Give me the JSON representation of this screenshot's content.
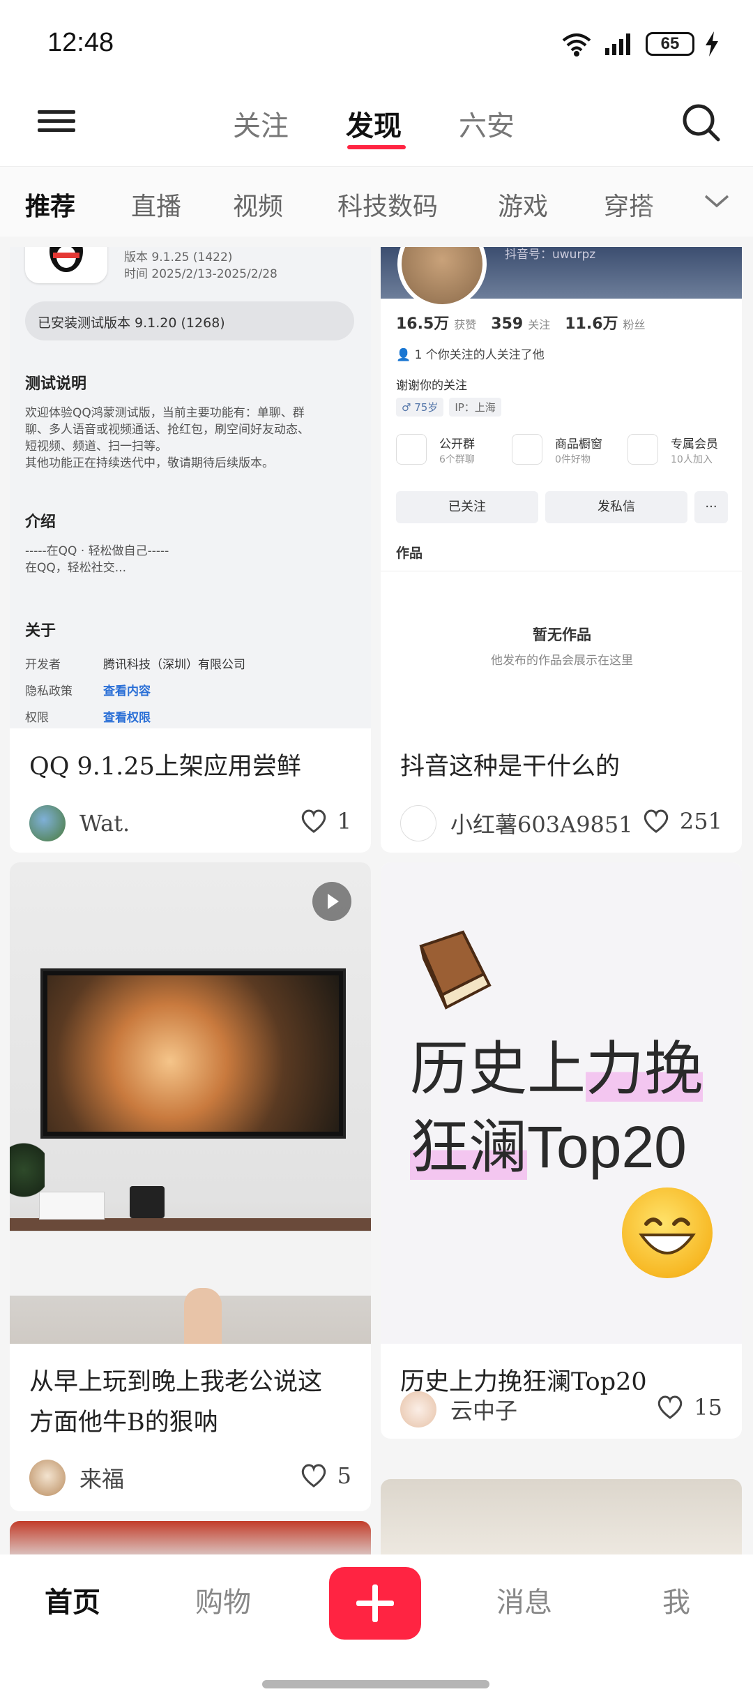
{
  "status_bar": {
    "time": "12:48",
    "battery": "65"
  },
  "top_nav": {
    "tabs": [
      "关注",
      "发现",
      "六安"
    ],
    "active_index": 1
  },
  "categories": {
    "items": [
      "推荐",
      "直播",
      "视频",
      "科技数码",
      "游戏",
      "穿搭"
    ],
    "active_index": 0
  },
  "feed": [
    {
      "title": "QQ 9.1.25上架应用尝鲜",
      "author": "Wat.",
      "likes": "1",
      "screenshot": {
        "version": "版本  9.1.25 (1422)",
        "time": "时间  2025/2/13-2025/2/28",
        "installed": "已安装测试版本 9.1.20 (1268)",
        "test_heading": "测试说明",
        "test_body": [
          "欢迎体验QQ鸿蒙测试版，当前主要功能有：单聊、群",
          "聊、多人语音或视频通话、抢红包，刷空间好友动态、",
          "短视频、频道、扫一扫等。",
          "其他功能正在持续迭代中，敬请期待后续版本。"
        ],
        "intro_heading": "介绍",
        "intro_body": [
          "-----在QQ · 轻松做自己-----",
          "在QQ，轻松社交..."
        ],
        "about_heading": "关于",
        "about_rows": [
          {
            "k": "开发者",
            "v": "腾讯科技（深圳）有限公司"
          },
          {
            "k": "隐私政策",
            "v": "查看内容"
          },
          {
            "k": "权限",
            "v": "查看权限"
          }
        ]
      }
    },
    {
      "title": "抖音这种是干什么的",
      "author": "小红薯603A9851",
      "likes": "251",
      "screenshot": {
        "handle": "抖音号：uwurpz",
        "stats": [
          {
            "num": "16.5万",
            "label": "获赞"
          },
          {
            "num": "359",
            "label": "关注"
          },
          {
            "num": "11.6万",
            "label": "粉丝"
          }
        ],
        "mutual": "1 个你关注的人关注了他",
        "bio": "谢谢你的关注",
        "tags": [
          "♂ 75岁",
          "IP：上海"
        ],
        "features": [
          {
            "title": "公开群",
            "sub": "6个群聊"
          },
          {
            "title": "商品橱窗",
            "sub": "0件好物"
          },
          {
            "title": "专属会员",
            "sub": "10人加入"
          }
        ],
        "followed_btn": "已关注",
        "message_btn": "发私信",
        "more_btn": "···",
        "works_tab": "作品",
        "empty_title": "暂无作品",
        "empty_sub": "他发布的作品会展示在这里"
      }
    },
    {
      "title": "从早上玩到晚上我老公说这方面他牛B的狠呐",
      "title_lines": [
        "从早上玩到晚上我老公说这",
        "方面他牛B的狠呐"
      ],
      "author": "来福",
      "likes": "5"
    },
    {
      "title": "历史上力挽狂澜Top20",
      "cover_lines": [
        "历史上力挽",
        "狂澜Top20"
      ],
      "author": "云中子",
      "likes": "15"
    }
  ],
  "bottom_nav": {
    "tabs": [
      "首页",
      "购物",
      "消息",
      "我"
    ],
    "active_index": 0
  },
  "colors": {
    "accent": "#ff2442",
    "link_blue": "#2a6fd6",
    "highlight_pink": "#f3c6f0"
  }
}
